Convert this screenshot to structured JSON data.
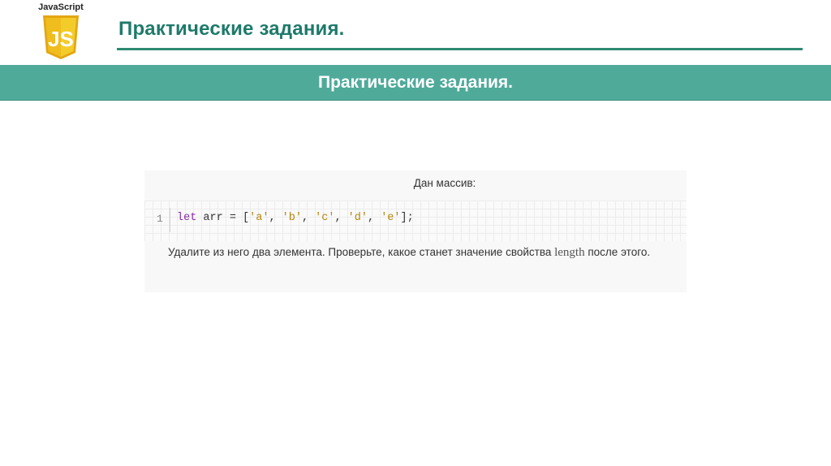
{
  "logo": {
    "label": "JavaScript",
    "badge_text": "JS",
    "badge_color": "#f0c419",
    "badge_shade": "#e3a612"
  },
  "header": {
    "title": "Практические задания."
  },
  "banner": {
    "title": "Практические задания."
  },
  "task": {
    "heading": "Дан массив:",
    "line_number": "1",
    "code": {
      "keyword": "let",
      "name": " arr = [",
      "items": [
        "'a'",
        "'b'",
        "'c'",
        "'d'",
        "'e'"
      ],
      "separator": ", ",
      "end": "];"
    },
    "text_before": "Удалите из него два элемента. Проверьте, какое станет значение свойства ",
    "inline_code": "length",
    "text_after": " после этого."
  },
  "colors": {
    "accent": "#1e7a6a",
    "banner": "#4faa9a",
    "keyword": "#8a2da8",
    "string": "#b8860b"
  }
}
